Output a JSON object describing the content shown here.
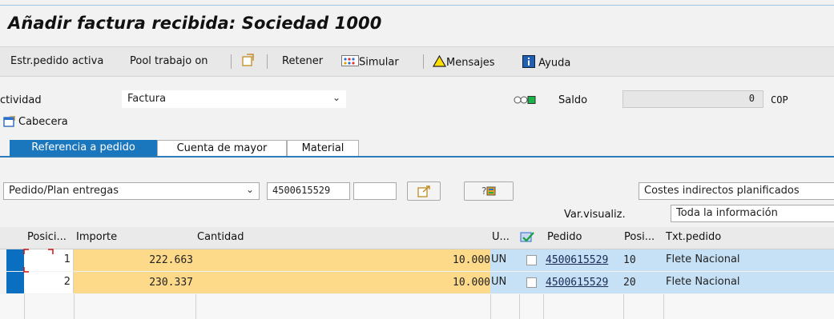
{
  "header": {
    "title": "Añadir factura recibida: Sociedad 1000"
  },
  "toolbar": {
    "estr_pedido": "Estr.pedido activa",
    "pool": "Pool trabajo on",
    "retener": "Retener",
    "simular": "Simular",
    "mensajes": "Mensajes",
    "ayuda": "Ayuda"
  },
  "form": {
    "actividad_label": "ctividad",
    "actividad_value": "Factura",
    "saldo_label": "Saldo",
    "saldo_value": "0",
    "saldo_currency": "COP",
    "cabecera_label": "Cabecera"
  },
  "tabs": [
    {
      "label": "Referencia a pedido",
      "active": true
    },
    {
      "label": "Cuenta de mayor",
      "active": false
    },
    {
      "label": "Material",
      "active": false
    }
  ],
  "reference": {
    "type_value": "Pedido/Plan entregas",
    "order_number": "4500615529",
    "second_field": "",
    "costs_dropdown": "Costes indirectos planificados",
    "var_visualiz_label": "Var.visualiz.",
    "var_visualiz_value": "Toda la información"
  },
  "grid": {
    "columns": [
      "Posici...",
      "Importe",
      "Cantidad",
      "U...",
      "",
      "Pedido",
      "Posi...",
      "Txt.pedido"
    ],
    "rows": [
      {
        "pos": "1",
        "importe": "222.663",
        "cantidad": "10.000",
        "unit": "UN",
        "pedido": "4500615529",
        "posi": "10",
        "txt": "Flete Nacional"
      },
      {
        "pos": "2",
        "importe": "230.337",
        "cantidad": "10.000",
        "unit": "UN",
        "pedido": "4500615529",
        "posi": "20",
        "txt": "Flete Nacional"
      }
    ]
  },
  "colors": {
    "accent": "#1a76bd",
    "row_highlight": "#c6e0f5",
    "amount_fill": "#fdd98a"
  }
}
